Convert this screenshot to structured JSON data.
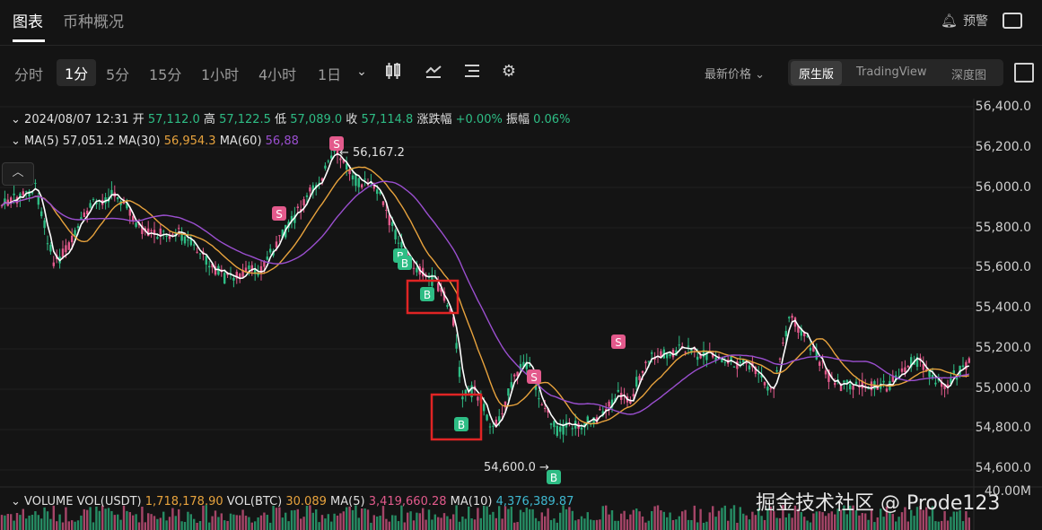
{
  "top_tabs": [
    "图表",
    "币种概况"
  ],
  "alert_label": "预警",
  "intervals": [
    "分时",
    "1分",
    "5分",
    "15分",
    "1小时",
    "4小时",
    "1日"
  ],
  "price_select": "最新价格",
  "view_modes": [
    "原生版",
    "TradingView",
    "深度图"
  ],
  "ohlc": {
    "datetime": "2024/08/07 12:31",
    "open_label": "开",
    "open": "57,112.0",
    "high_label": "高",
    "high": "57,122.5",
    "low_label": "低",
    "low": "57,089.0",
    "close_label": "收",
    "close": "57,114.8",
    "change_label": "涨跌幅",
    "change": "+0.00%",
    "amp_label": "振幅",
    "amp": "0.06%"
  },
  "ma": {
    "ma5_label": "MA(5)",
    "ma5": "57,051.2",
    "ma30_label": "MA(30)",
    "ma30": "56,954.3",
    "ma60_label": "MA(60)",
    "ma60": "56,88"
  },
  "volume": {
    "title": "VOLUME",
    "vol_usdt_label": "VOL(USDT)",
    "vol_usdt": "1,718,178.90",
    "vol_btc_label": "VOL(BTC)",
    "vol_btc": "30.089",
    "ma5_label": "MA(5)",
    "ma5": "3,419,660.28",
    "ma10_label": "MA(10)",
    "ma10": "4,376,389.87"
  },
  "y_axis": [
    "56,400.0",
    "56,200.0",
    "56,000.0",
    "55,800.0",
    "55,600.0",
    "55,400.0",
    "55,200.0",
    "55,000.0",
    "54,800.0",
    "54,600.0",
    "40.00M"
  ],
  "annotations": {
    "high": "← 56,167.2",
    "low": "54,600.0 →"
  },
  "markers": {
    "buy": "B",
    "sell": "S"
  },
  "watermark": "掘金技术社区 @ Prode123",
  "colors": {
    "up": "#2ebd85",
    "down": "#e35a8c",
    "ma5": "#ffffff",
    "ma30": "#e8a33d",
    "ma60": "#9b4fd0",
    "highlight": "#e02424"
  }
}
